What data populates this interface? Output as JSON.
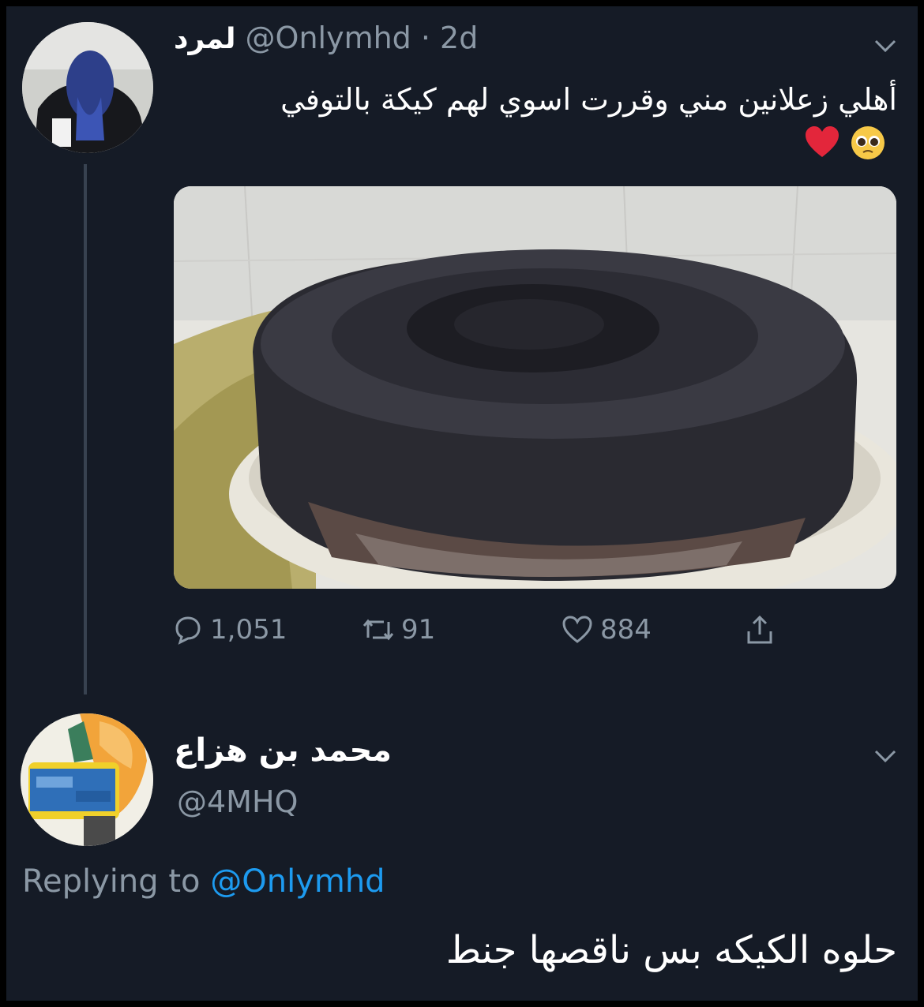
{
  "tweet": {
    "display_name": "لمرد",
    "handle_time": "@Onlymhd · 2d",
    "text": "أهلي زعلانين مني وقررت اسوي لهم كيكة بالتوفي",
    "emojis": [
      "pleading-face",
      "red-heart"
    ],
    "stats": {
      "replies": "1,051",
      "retweets": "91",
      "likes": "884"
    }
  },
  "reply": {
    "display_name": "محمد بن هزاع",
    "handle": "@4MHQ",
    "replying_prefix": "Replying to",
    "replying_to": "@Onlymhd",
    "text": "حلوه الكيكه بس ناقصها جنط"
  },
  "icons": {
    "reply": "speech-bubble-icon",
    "retweet": "retweet-icon",
    "like": "heart-icon",
    "share": "share-icon",
    "more": "chevron-down-icon"
  },
  "colors": {
    "background": "#151b26",
    "muted_text": "#8b98a5",
    "link": "#1d9bf0"
  }
}
